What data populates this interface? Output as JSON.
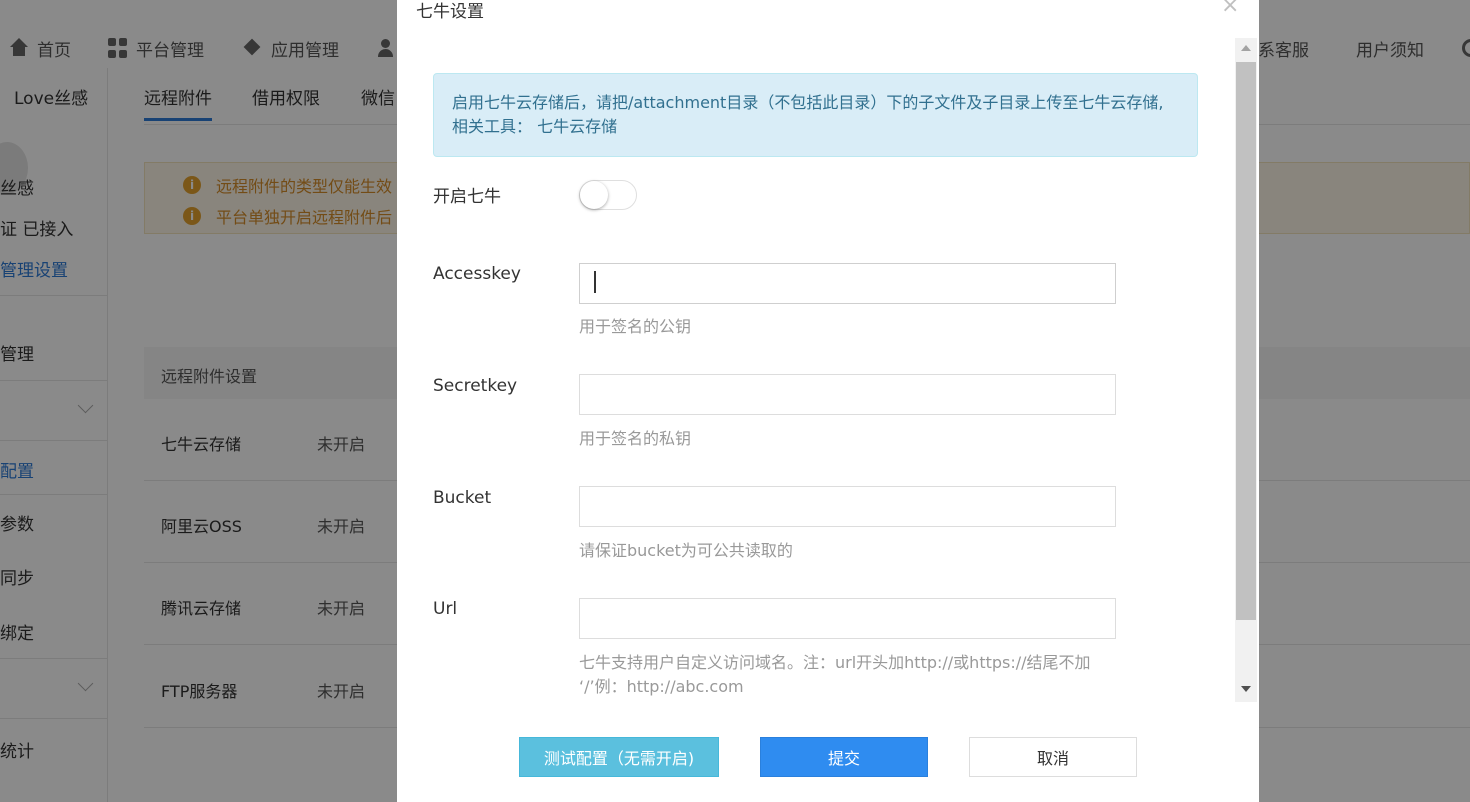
{
  "nav": {
    "home": "首页",
    "platform": "平台管理",
    "app": "应用管理",
    "contact": "系客服",
    "notice": "用户须知"
  },
  "sidebar": {
    "account": "Love丝感",
    "items": [
      "丝感",
      "证 已接入",
      "管理设置",
      "管理",
      "配置",
      "参数",
      "同步",
      "绑定",
      "统计"
    ]
  },
  "tabs": [
    "远程附件",
    "借用权限",
    "微信"
  ],
  "alerts": [
    "远程附件的类型仅能生效",
    "平台单独开启远程附件后"
  ],
  "table": {
    "header": "远程附件设置",
    "rows": [
      {
        "name": "七牛云存储",
        "status": "未开启"
      },
      {
        "name": "阿里云OSS",
        "status": "未开启"
      },
      {
        "name": "腾讯云存储",
        "status": "未开启"
      },
      {
        "name": "FTP服务器",
        "status": "未开启"
      }
    ]
  },
  "modal": {
    "title": "七牛设置",
    "close": "×",
    "info": "启用七牛云存储后，请把/attachment目录（不包括此目录）下的子文件及子目录上传至七牛云存储, 相关工具： 七牛云存储",
    "enable_label": "开启七牛",
    "enabled": false,
    "fields": [
      {
        "label": "Accesskey",
        "value": "",
        "placeholder": "",
        "help": "用于签名的公钥"
      },
      {
        "label": "Secretkey",
        "value": "",
        "placeholder": "",
        "help": "用于签名的私钥"
      },
      {
        "label": "Bucket",
        "value": "",
        "placeholder": "",
        "help": "请保证bucket为可公共读取的"
      },
      {
        "label": "Url",
        "value": "",
        "placeholder": "",
        "help": "七牛支持用户自定义访问域名。注：url开头加http://或https://结尾不加 ‘/’例：http://abc.com"
      }
    ],
    "buttons": {
      "test": "测试配置（无需开启)",
      "submit": "提交",
      "cancel": "取消"
    }
  },
  "colors": {
    "primary": "#2f8cf0",
    "info_btn": "#5bc0de",
    "info_box_bg": "#d9edf7",
    "info_box_text": "#31708f",
    "alert_text": "#d58c2a"
  }
}
